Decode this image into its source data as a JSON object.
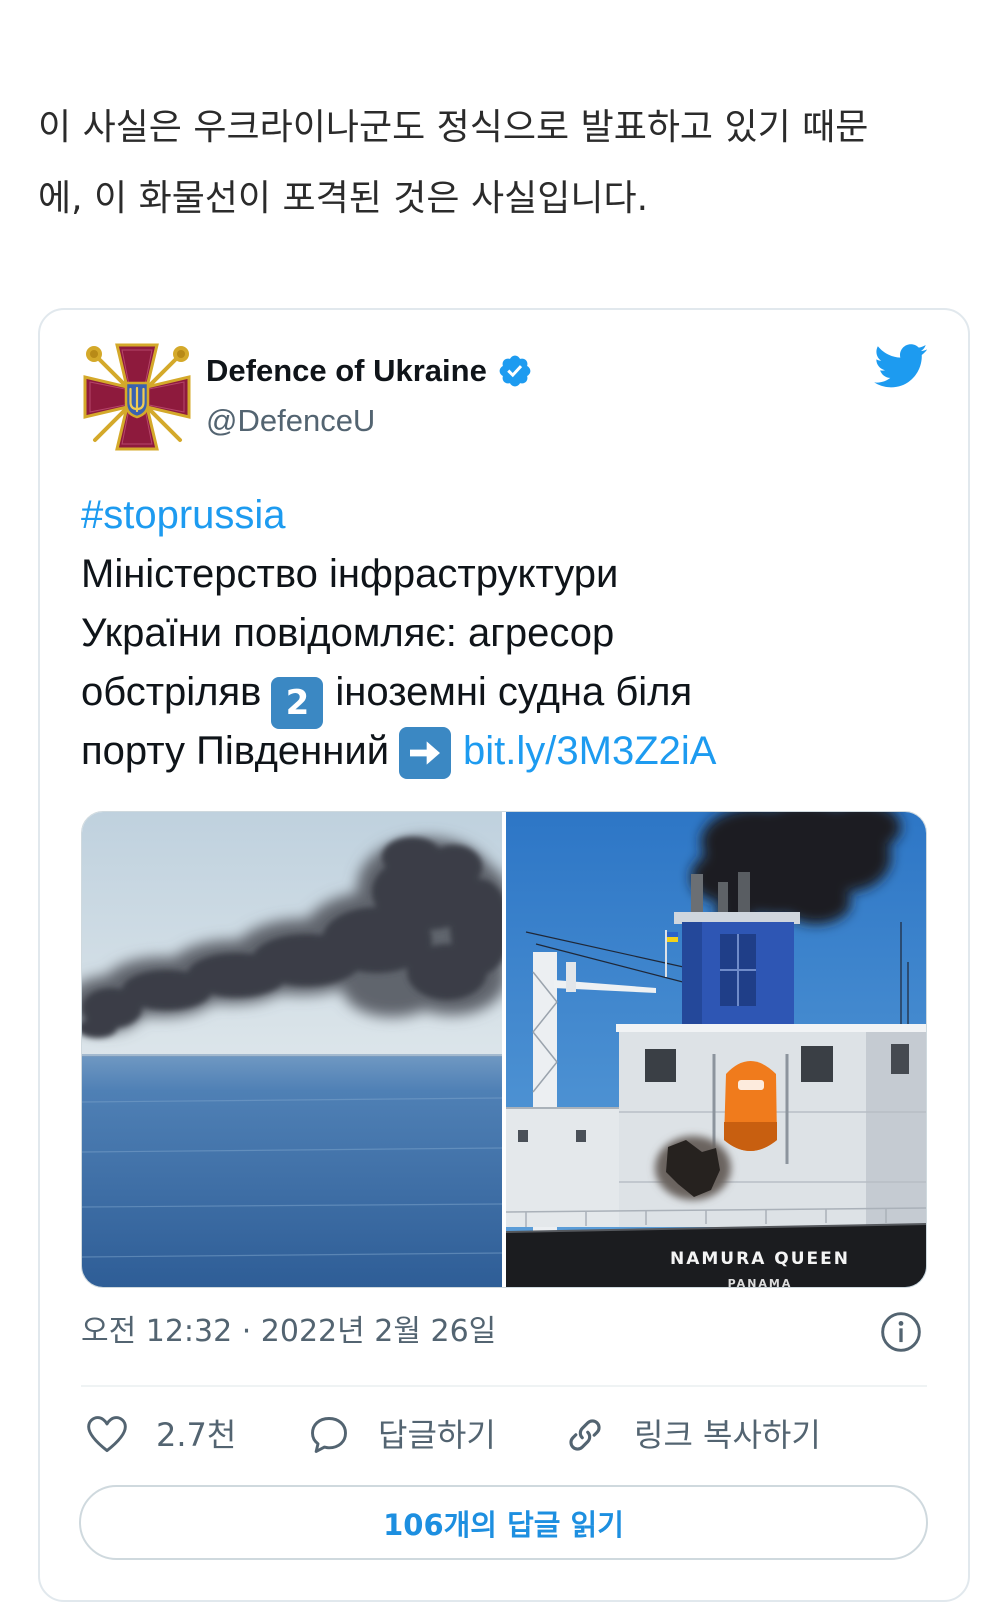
{
  "article": {
    "paragraph_lines": [
      "이 사실은 우크라이나군도 정식으로 발표하고 있기 때문",
      "에, 이 화물선이 포격된 것은 사실입니다."
    ]
  },
  "tweet": {
    "author": {
      "name": "Defence of Ukraine",
      "handle": "@DefenceU",
      "verified": true
    },
    "text": {
      "hashtag": "#stoprussia",
      "line1": "Міністерство інфраструктури",
      "line2": "України повідомляє: агресор",
      "line3_before": "обстріляв",
      "keycap_digit": "2",
      "line3_after": "іноземні судна біля",
      "line4_before": "порту Південний",
      "link": "bit.ly/3M3Z2iA"
    },
    "media": {
      "ship_hull_name": "NAMURA QUEEN",
      "ship_port": "PANAMA"
    },
    "timestamp": "오전 12:32 · 2022년 2월 26일",
    "actions": {
      "likes": "2.7천",
      "reply_label": "답글하기",
      "copy_link_label": "링크 복사하기"
    },
    "read_replies_label": "106개의 답글 읽기"
  },
  "icons": {
    "avatar": "ministry-of-defence-emblem-icon",
    "verified": "verified-badge-icon",
    "brand": "twitter-bird-icon",
    "arrow_emoji": "right-arrow-emoji-icon",
    "info": "info-icon",
    "like": "heart-icon",
    "reply": "speech-bubble-icon",
    "copy_link": "link-icon"
  },
  "colors": {
    "accent": "#1d9bf0",
    "text_primary": "#0f1419",
    "text_secondary": "#536471",
    "border": "#cfd9de",
    "emoji_key": "#3b88c3",
    "avatar_cross": "#8e1a3d",
    "avatar_gold": "#d4a92a"
  }
}
